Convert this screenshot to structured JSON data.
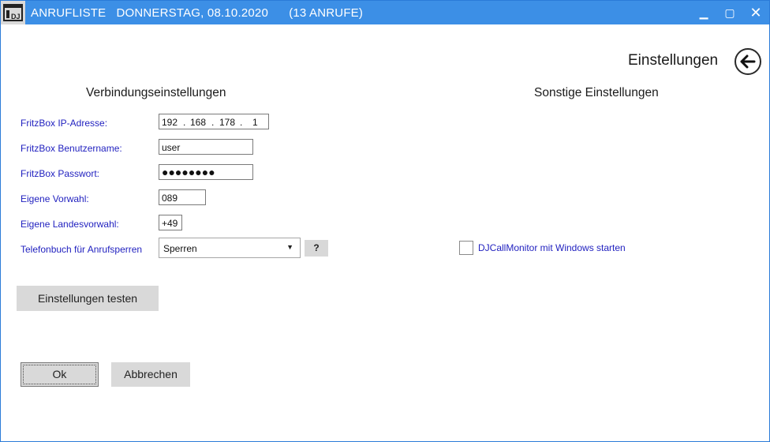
{
  "window": {
    "title": "ANRUFLISTE   DONNERSTAG, 08.10.2020      (13 ANRUFE)",
    "app_icon_text": "DJ",
    "controls": {
      "minimize": "▁",
      "maximize": "▢",
      "close": "✕"
    }
  },
  "header": {
    "page_title": "Einstellungen",
    "back_icon": "arrow-left-icon"
  },
  "left_section": {
    "title": "Verbindungseinstellungen",
    "ip_label": "FritzBox IP-Adresse:",
    "ip_parts": [
      "192",
      "168",
      "178",
      "1"
    ],
    "user_label": "FritzBox Benutzername:",
    "user_value": "user",
    "password_label": "FritzBox Passwort:",
    "password_value": "●●●●●●●●",
    "area_code_label": "Eigene Vorwahl:",
    "area_code_value": "089",
    "country_code_label": "Eigene Landesvorwahl:",
    "country_code_value": "+49",
    "phonebook_label": "Telefonbuch für Anrufsperren",
    "phonebook_selected": "Sperren",
    "help_label": "?",
    "test_button": "Einstellungen testen"
  },
  "right_section": {
    "title": "Sonstige Einstellungen",
    "autostart_label": "DJCallMonitor mit Windows starten",
    "autostart_checked": false
  },
  "footer": {
    "ok_label": "Ok",
    "cancel_label": "Abbrechen"
  },
  "colors": {
    "titlebar": "#3c8fe6",
    "label_blue": "#1f1fbf",
    "button_gray": "#d9d9d9"
  }
}
